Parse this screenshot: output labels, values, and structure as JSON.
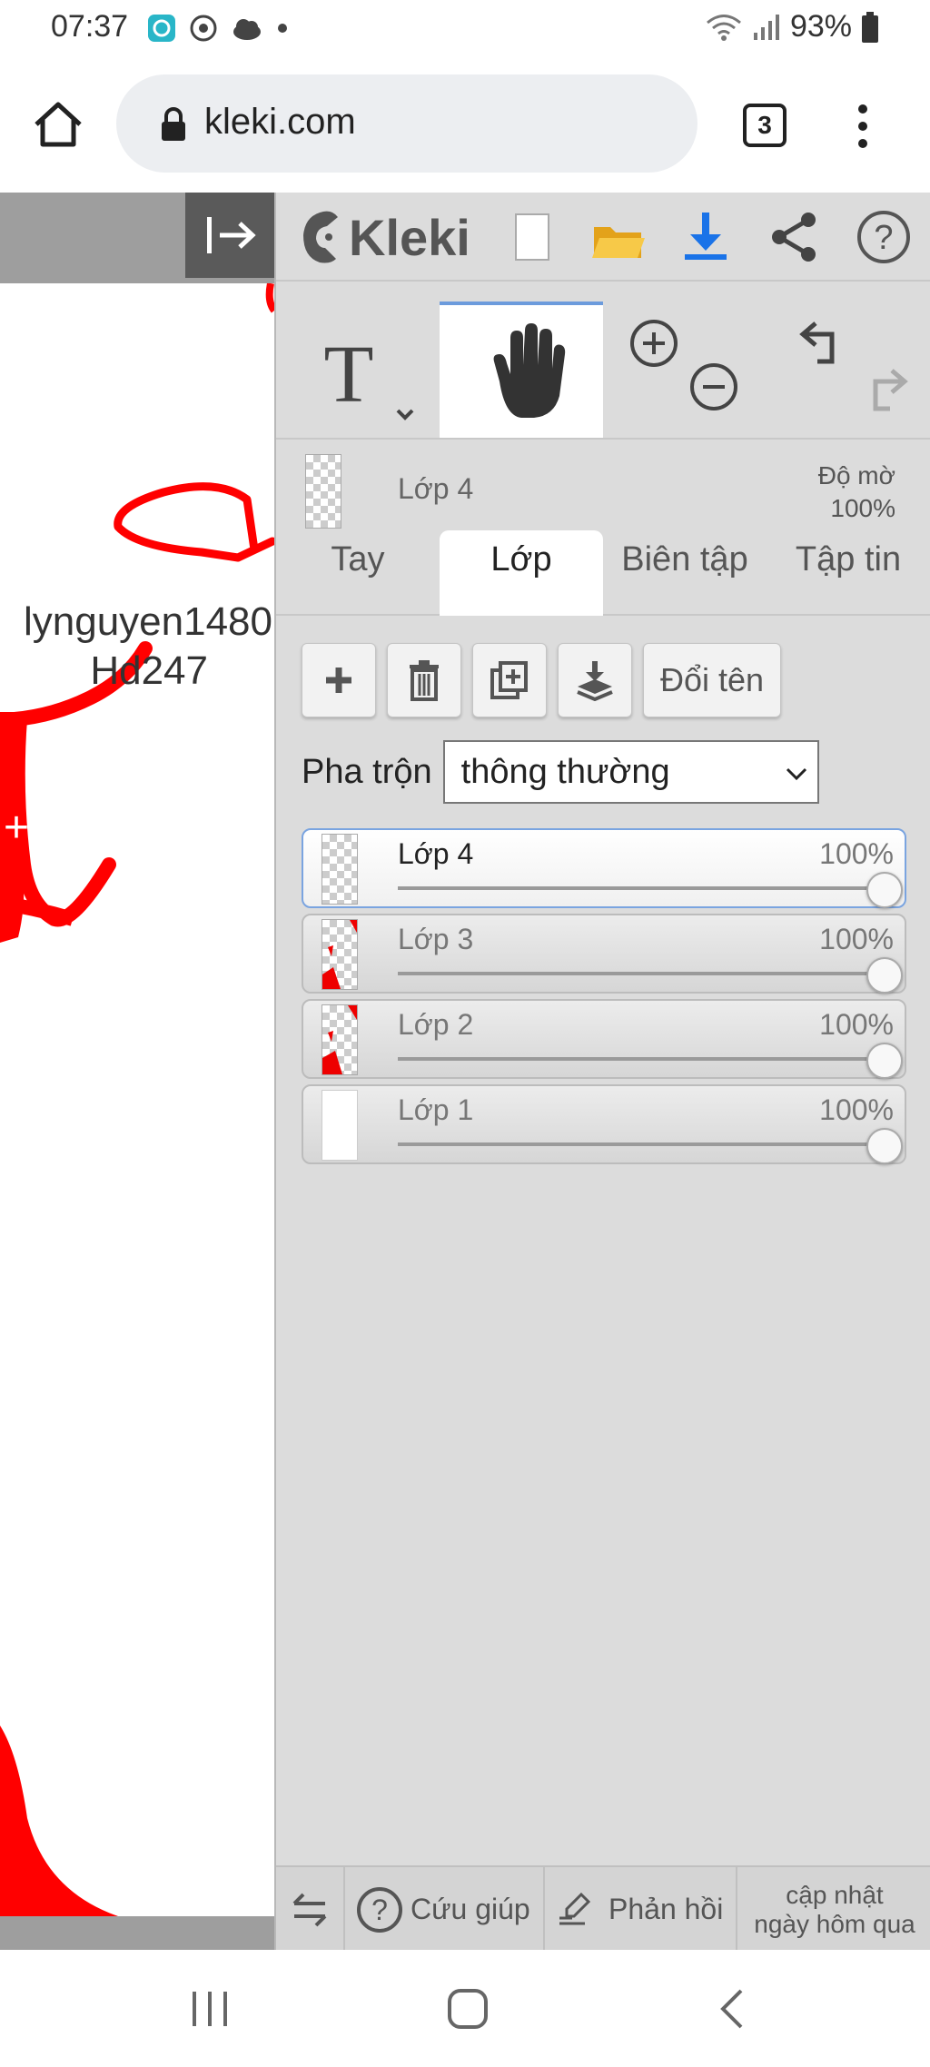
{
  "status_bar": {
    "time": "07:37",
    "battery": "93%"
  },
  "browser": {
    "url": "kleki.com",
    "tab_count": "3"
  },
  "canvas": {
    "text_line1": "lynguyen1480",
    "text_line2": "Hd247"
  },
  "app": {
    "logo": "Kleki",
    "current_layer": {
      "name": "Lớp 4",
      "opacity_label": "Độ mờ",
      "opacity_value": "100%"
    },
    "tabs": [
      {
        "label": "Tay"
      },
      {
        "label": "Lớp"
      },
      {
        "label": "Biên tập"
      },
      {
        "label": "Tập tin"
      }
    ],
    "actions": {
      "rename": "Đổi tên"
    },
    "blend": {
      "label": "Pha trộn",
      "value": "thông thường"
    },
    "layers": [
      {
        "name": "Lớp 4",
        "opacity": "100%",
        "selected": true
      },
      {
        "name": "Lớp 3",
        "opacity": "100%",
        "selected": false
      },
      {
        "name": "Lớp 2",
        "opacity": "100%",
        "selected": false
      },
      {
        "name": "Lớp 1",
        "opacity": "100%",
        "selected": false
      }
    ],
    "footer": {
      "help": "Cứu giúp",
      "feedback": "Phản hồi",
      "update_line1": "cập nhật",
      "update_line2": "ngày hôm qua"
    }
  },
  "colors": {
    "accent_blue": "#1a73e8",
    "drawing_red": "#ff0000",
    "folder_yellow": "#f5b800"
  }
}
